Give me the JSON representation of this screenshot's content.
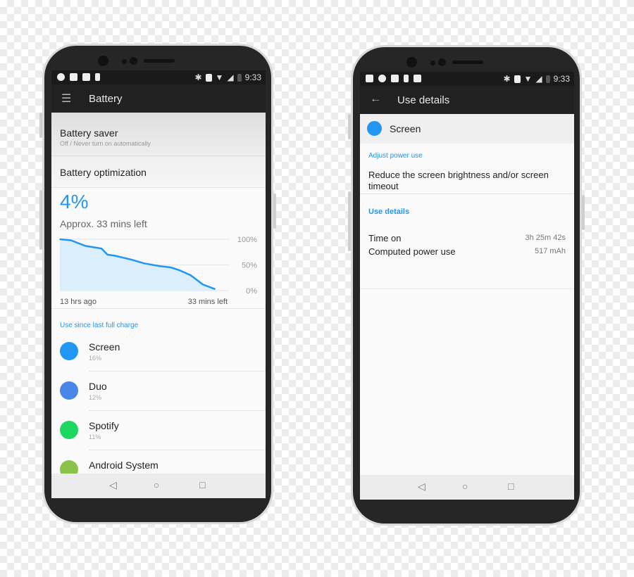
{
  "left_phone": {
    "status": {
      "time": "9:33"
    },
    "toolbar": {
      "title": "Battery",
      "menu_icon": "hamburger-icon"
    },
    "battery_saver": {
      "title": "Battery saver",
      "subtitle": "Off / Never turn on automatically"
    },
    "battery_optimization": {
      "title": "Battery optimization"
    },
    "level": "4%",
    "remaining": "Approx. 33 mins left",
    "chart_data": {
      "type": "area",
      "y_ticks": [
        "100%",
        "50%",
        "0%"
      ],
      "ylim": [
        0,
        100
      ],
      "x_start_label": "13 hrs ago",
      "x_end_label": "33 mins left",
      "color": "#2196f3",
      "points": [
        [
          13,
          100
        ],
        [
          12.1,
          98
        ],
        [
          10.9,
          87
        ],
        [
          9.6,
          82
        ],
        [
          9.1,
          70
        ],
        [
          8.5,
          68
        ],
        [
          7.1,
          60
        ],
        [
          6.1,
          53
        ],
        [
          4.9,
          48
        ],
        [
          3.9,
          45
        ],
        [
          3.25,
          40
        ],
        [
          2.3,
          30
        ],
        [
          1.3,
          12
        ],
        [
          0.3,
          3
        ]
      ]
    },
    "section_label": "Use since last full charge",
    "apps": [
      {
        "name": "Screen",
        "percent": "16%",
        "icon": "brightness-icon",
        "color": "#2196f3"
      },
      {
        "name": "Duo",
        "percent": "12%",
        "icon": "duo-icon",
        "color": "#4a86e8"
      },
      {
        "name": "Spotify",
        "percent": "11%",
        "icon": "spotify-icon",
        "color": "#1ed760"
      },
      {
        "name": "Android System",
        "percent": "",
        "icon": "android-system-icon",
        "color": "#8bc34a"
      }
    ]
  },
  "right_phone": {
    "status": {
      "time": "9:33"
    },
    "toolbar": {
      "title": "Use details",
      "back_icon": "arrow-left-icon"
    },
    "header": {
      "title": "Screen",
      "icon": "brightness-icon"
    },
    "adjust_label": "Adjust power use",
    "adjust_text": "Reduce the screen brightness and/or screen timeout",
    "details_label": "Use details",
    "details": [
      {
        "label": "Time on",
        "value": "3h 25m 42s"
      },
      {
        "label": "Computed power use",
        "value": "517 mAh"
      }
    ]
  },
  "nav": {
    "back": "◁",
    "home": "○",
    "recents": "□"
  }
}
